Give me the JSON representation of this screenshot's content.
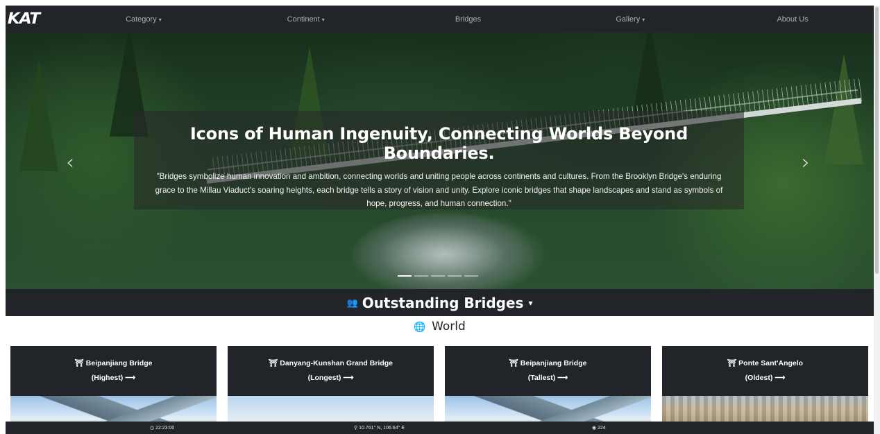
{
  "brand": {
    "logo_text": "KAT"
  },
  "nav": {
    "items": [
      {
        "label": "Category",
        "caret": "▾"
      },
      {
        "label": "Continent",
        "caret": "▾"
      },
      {
        "label": "Bridges",
        "caret": ""
      },
      {
        "label": "Gallery",
        "caret": "▾"
      },
      {
        "label": "About Us",
        "caret": ""
      }
    ]
  },
  "hero": {
    "title": "Icons of Human Ingenuity, Connecting Worlds Beyond Boundaries.",
    "text": "\"Bridges symbolize human innovation and ambition, connecting worlds and uniting people across continents and cultures. From the Brooklyn Bridge's enduring grace to the Millau Viaduct's soaring heights, each bridge tells a story of vision and unity. Explore iconic bridges that shape landscapes and stand as symbols of hope, progress, and human connection.\"",
    "prev_glyph": "‹",
    "next_glyph": "›",
    "indicator_count": 5,
    "active_indicator": 1
  },
  "outstanding": {
    "icon": "people-icon",
    "glyph": "👥",
    "label": "Outstanding Bridges",
    "caret": "▾"
  },
  "world": {
    "icon": "globe-icon",
    "glyph": "🌐",
    "label": "World"
  },
  "cards": [
    {
      "title": "Beipanjiang Bridge",
      "subtitle": "(Highest)",
      "arrow": "⟶",
      "image": "mountain-bridge-image"
    },
    {
      "title": "Danyang-Kunshan Grand Bridge",
      "subtitle": "(Longest)",
      "arrow": "⟶",
      "image": "sky-bridge-image"
    },
    {
      "title": "Beipanjiang Bridge",
      "subtitle": "(Tallest)",
      "arrow": "⟶",
      "image": "mountain-bridge-image"
    },
    {
      "title": "Ponte Sant'Angelo",
      "subtitle": "(Oldest)",
      "arrow": "⟶",
      "image": "city-bridge-image"
    }
  ],
  "card_icon_glyph": "⛩",
  "status": {
    "time": "22:23:00",
    "time_icon": "clock-icon",
    "coords": "10.761° N, 106.64° E",
    "coords_icon": "map-pin-icon",
    "views": "224",
    "views_icon": "eye-icon"
  }
}
